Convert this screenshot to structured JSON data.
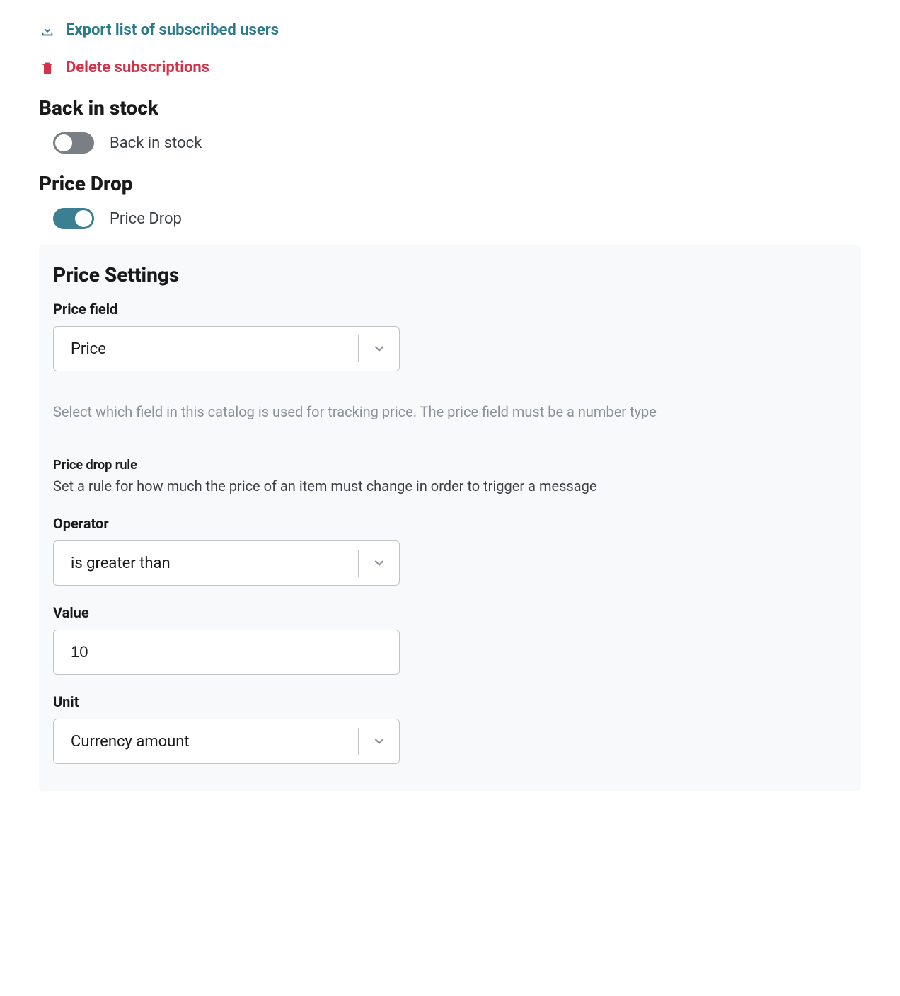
{
  "actions": {
    "export_label": "Export list of subscribed users",
    "delete_label": "Delete subscriptions"
  },
  "sections": {
    "back_in_stock": {
      "heading": "Back in stock",
      "toggle_label": "Back in stock"
    },
    "price_drop": {
      "heading": "Price Drop",
      "toggle_label": "Price Drop"
    }
  },
  "price_settings": {
    "heading": "Price Settings",
    "price_field": {
      "label": "Price field",
      "value": "Price",
      "help": "Select which field in this catalog is used for tracking price. The price field must be a number type"
    },
    "rule": {
      "label": "Price drop rule",
      "description": "Set a rule for how much the price of an item must change in order to trigger a message"
    },
    "operator": {
      "label": "Operator",
      "value": "is greater than"
    },
    "value": {
      "label": "Value",
      "value": "10"
    },
    "unit": {
      "label": "Unit",
      "value": "Currency amount"
    }
  }
}
